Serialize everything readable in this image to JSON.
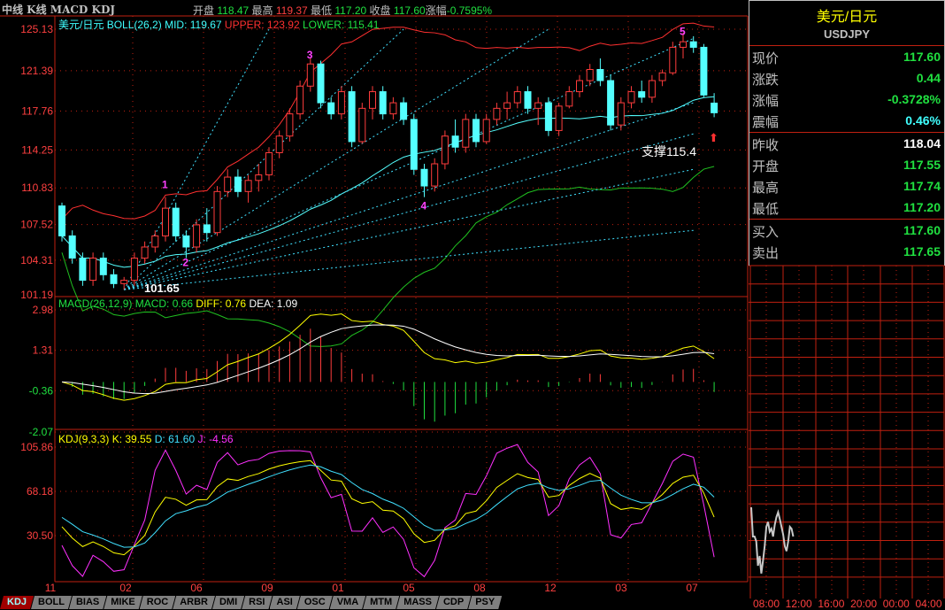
{
  "header": {
    "title": "中线 K线 MACD KDJ",
    "open_label": "开盘",
    "open": "118.47",
    "high_label": "最高",
    "high": "119.37",
    "low_label": "最低",
    "low": "117.20",
    "close_label": "收盘",
    "close": "117.60",
    "change_label": "涨幅",
    "change": "-0.7595%"
  },
  "main_panel": {
    "name": "美元/日元",
    "boll": "BOLL(26,2)",
    "mid": "MID: 119.67",
    "upper": "UPPER: 123.92",
    "lower": "LOWER: 115.41"
  },
  "macd_panel": {
    "name": "MACD(26,12,9)",
    "macd": "MACD: 0.66",
    "diff": "DIFF: 0.76",
    "dea": "DEA: 1.09"
  },
  "kdj_panel": {
    "name": "KDJ(9,3,3)",
    "k": "K: 39.55",
    "d": "D: 61.60",
    "j": "J: -4.56"
  },
  "annotations": {
    "low_label": "101.65",
    "support_label": "支撑115.4",
    "waves": [
      "1",
      "2",
      "3",
      "4",
      "5"
    ]
  },
  "quote": {
    "name": "美元/日元",
    "code": "USDJPY",
    "rows": [
      {
        "label": "现价",
        "value": "117.60",
        "color": "#20e040"
      },
      {
        "label": "涨跌",
        "value": "0.44",
        "color": "#20e040"
      },
      {
        "label": "涨幅",
        "value": "-0.3728%",
        "color": "#20e040"
      },
      {
        "label": "震幅",
        "value": "0.46%",
        "color": "#40ffff"
      },
      {
        "label": "昨收",
        "value": "118.04",
        "color": "#ffffff"
      },
      {
        "label": "开盘",
        "value": "117.55",
        "color": "#20e040"
      },
      {
        "label": "最高",
        "value": "117.74",
        "color": "#20e040"
      },
      {
        "label": "最低",
        "value": "117.20",
        "color": "#20e040"
      },
      {
        "label": "买入",
        "value": "117.60",
        "color": "#20e040"
      },
      {
        "label": "卖出",
        "value": "117.65",
        "color": "#20e040"
      }
    ]
  },
  "tabs": [
    "KDJ",
    "BOLL",
    "BIAS",
    "MIKE",
    "ROC",
    "ARBR",
    "DMI",
    "RSI",
    "ASI",
    "OSC",
    "VMA",
    "MTM",
    "MASS",
    "CDP",
    "PSY"
  ],
  "intraday_times": [
    "08:00",
    "12:00",
    "16:00",
    "20:00",
    "00:00",
    "04:00"
  ],
  "colors": {
    "up": "#ff3c3c",
    "down": "#54ffff",
    "grid": "#c02010",
    "mid": "#c0c0c0",
    "upper": "#ff3030",
    "lower": "#20c020",
    "diff": "#ffff00",
    "dea": "#ffffff",
    "k": "#ffff00",
    "d": "#40e0ff",
    "j": "#ff30ff"
  },
  "chart_data": [
    {
      "type": "candlestick",
      "title": "美元/日元",
      "ylim": [
        101.19,
        125.13
      ],
      "yticks": [
        "125.13",
        "121.39",
        "117.76",
        "114.25",
        "110.83",
        "107.52",
        "104.31",
        "101.19"
      ],
      "xticks": [
        "11",
        "02",
        "06",
        "09",
        "01",
        "05",
        "08",
        "12",
        "03",
        "07"
      ],
      "candles": [
        [
          109.2,
          109.5,
          106,
          106.5
        ],
        [
          106.5,
          107,
          104,
          104.5
        ],
        [
          104.5,
          105,
          102,
          102.5
        ],
        [
          102.5,
          105,
          102,
          104.5
        ],
        [
          104.5,
          105,
          102.5,
          103
        ],
        [
          103,
          103.5,
          101.8,
          102.2
        ],
        [
          102.2,
          102.8,
          101.65,
          102.5
        ],
        [
          102.5,
          105,
          102,
          104.5
        ],
        [
          104.5,
          106,
          104,
          105.5
        ],
        [
          105.5,
          107,
          105,
          106.5
        ],
        [
          106.5,
          110,
          106,
          109
        ],
        [
          109,
          109.5,
          106,
          106.5
        ],
        [
          106.5,
          107,
          104.5,
          105.5
        ],
        [
          105.5,
          108,
          105,
          107.5
        ],
        [
          107.5,
          109,
          106,
          106.8
        ],
        [
          106.8,
          111,
          106.5,
          110.5
        ],
        [
          110.5,
          112.5,
          110,
          111.8
        ],
        [
          111.8,
          112.5,
          110,
          110.5
        ],
        [
          110.5,
          112,
          109.5,
          111.5
        ],
        [
          111.5,
          113,
          110.5,
          112
        ],
        [
          112,
          114.5,
          111.5,
          114
        ],
        [
          114,
          116,
          113.5,
          115.5
        ],
        [
          115.5,
          118,
          115,
          117.5
        ],
        [
          117.5,
          120.5,
          117,
          120
        ],
        [
          120,
          122.5,
          119.5,
          122
        ],
        [
          122,
          122.3,
          118,
          118.5
        ],
        [
          118.5,
          119,
          117,
          117.5
        ],
        [
          117.5,
          120,
          117,
          119.5
        ],
        [
          119.5,
          120,
          114.5,
          115
        ],
        [
          115,
          118.5,
          114.8,
          118
        ],
        [
          118,
          120,
          117,
          119.5
        ],
        [
          119.5,
          120,
          117,
          117.5
        ],
        [
          117.5,
          119,
          117,
          118.5
        ],
        [
          118.5,
          119,
          116.5,
          117
        ],
        [
          117,
          117.5,
          112,
          112.5
        ],
        [
          112.5,
          113,
          110,
          111
        ],
        [
          111,
          113.5,
          110.5,
          113
        ],
        [
          113,
          116,
          112.5,
          115.5
        ],
        [
          115.5,
          117,
          114,
          114.5
        ],
        [
          114.5,
          117.5,
          114,
          117
        ],
        [
          117,
          117.5,
          114.5,
          115
        ],
        [
          115,
          117.5,
          114.8,
          117
        ],
        [
          117,
          118.5,
          116.5,
          118
        ],
        [
          118,
          119.5,
          117,
          118.5
        ],
        [
          118.5,
          120,
          118,
          119.5
        ],
        [
          119.5,
          120,
          117.5,
          118
        ],
        [
          118,
          119,
          116.5,
          118.5
        ],
        [
          118.5,
          119,
          115.5,
          116
        ],
        [
          116,
          118.5,
          115.5,
          118.2
        ],
        [
          118.2,
          120,
          118,
          119.5
        ],
        [
          119.5,
          121,
          119,
          120.5
        ],
        [
          120.5,
          122,
          120,
          121.5
        ],
        [
          121.5,
          122.5,
          120,
          120.5
        ],
        [
          120.5,
          121,
          116,
          116.5
        ],
        [
          116.5,
          119,
          116,
          118.5
        ],
        [
          118.5,
          120,
          118,
          119.5
        ],
        [
          119.5,
          120.5,
          118.5,
          119
        ],
        [
          119,
          121,
          118.5,
          120.5
        ],
        [
          120.5,
          121.5,
          120,
          121.2
        ],
        [
          121.2,
          124,
          121,
          123.5
        ],
        [
          123.5,
          124.8,
          122.5,
          124
        ],
        [
          124,
          124.5,
          123,
          123.5
        ],
        [
          123.5,
          123.8,
          119,
          119.2
        ],
        [
          118.47,
          119.37,
          117.2,
          117.6
        ]
      ],
      "fan_lines": [
        {
          "from": [
            6,
            101.65
          ],
          "to": [
            20,
            125.13
          ]
        },
        {
          "from": [
            6,
            101.65
          ],
          "to": [
            33,
            125.13
          ]
        },
        {
          "from": [
            6,
            101.65
          ],
          "to": [
            47,
            125.13
          ]
        },
        {
          "from": [
            6,
            101.65
          ],
          "to": [
            61,
            124.3
          ]
        },
        {
          "from": [
            6,
            101.65
          ],
          "to": [
            61,
            118.5
          ]
        },
        {
          "from": [
            6,
            101.65
          ],
          "to": [
            61,
            115.7
          ]
        },
        {
          "from": [
            6,
            101.65
          ],
          "to": [
            61,
            112.5
          ]
        },
        {
          "from": [
            6,
            101.65
          ],
          "to": [
            61,
            107.0
          ]
        }
      ],
      "waves": [
        {
          "label": "1",
          "i": 10,
          "price": 110.8
        },
        {
          "label": "2",
          "i": 12,
          "price": 103.8
        },
        {
          "label": "3",
          "i": 24,
          "price": 122.5
        },
        {
          "label": "4",
          "i": 35,
          "price": 108.9
        },
        {
          "label": "5",
          "i": 60,
          "price": 124.6
        }
      ]
    },
    {
      "type": "bar+line",
      "title": "MACD(26,12,9)",
      "ylim": [
        -2.07,
        2.98
      ],
      "yticks": [
        "2.98",
        "1.31",
        "-0.36",
        "-2.07"
      ]
    },
    {
      "type": "line",
      "title": "KDJ(9,3,3)",
      "ylim": [
        -7,
        105.86
      ],
      "yticks": [
        "105.86",
        "68.18",
        "30.50"
      ]
    },
    {
      "type": "line",
      "title": "intraday",
      "values": [
        117.9,
        117.6,
        117.6,
        117.55,
        117.3,
        117.4,
        117.22,
        117.35,
        117.5,
        117.7,
        117.75,
        117.65,
        117.68,
        117.6,
        117.72,
        117.8,
        117.85,
        117.78,
        117.7,
        117.62,
        117.5,
        117.45,
        117.55,
        117.7,
        117.68,
        117.6
      ]
    }
  ]
}
